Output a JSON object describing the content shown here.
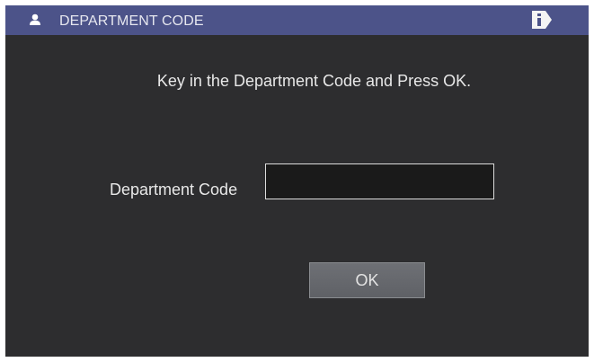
{
  "titlebar": {
    "title": "DEPARTMENT CODE",
    "user_icon": "user-icon",
    "info_icon": "info-icon",
    "color": "#4c5389"
  },
  "main": {
    "prompt": "Key in the Department Code and Press OK.",
    "field_label": "Department Code",
    "field_value": "",
    "ok_label": "OK"
  },
  "colors": {
    "background": "#2d2d2f",
    "field_background": "#1a1a1a",
    "button": "#67696e"
  }
}
